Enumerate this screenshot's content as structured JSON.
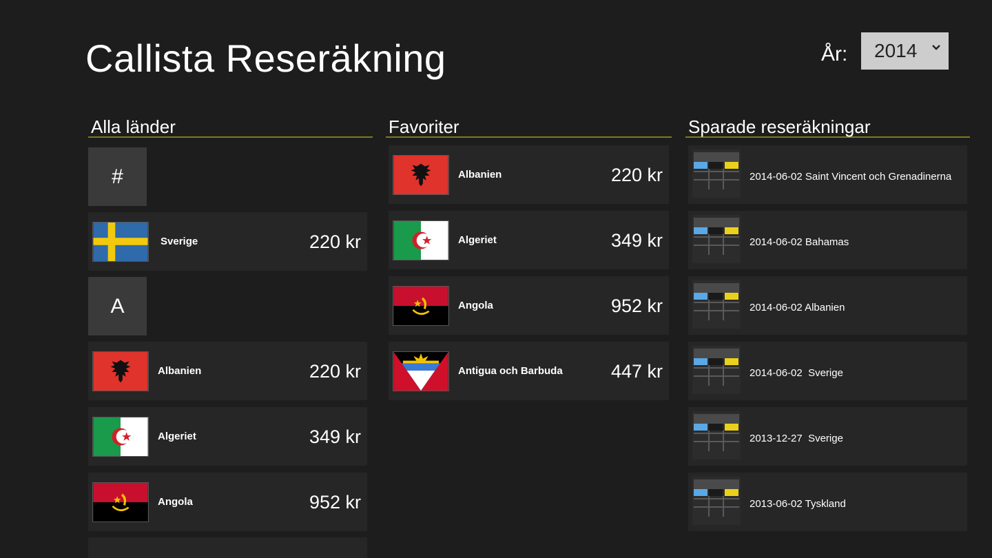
{
  "app": {
    "title": "Callista Reseräkning"
  },
  "year": {
    "label": "År:",
    "selected": "2014"
  },
  "sections": {
    "all": "Alla länder",
    "favorites": "Favoriter",
    "saved": "Sparade reseräkningar"
  },
  "all_countries": {
    "group_hash": "#",
    "group_a": "A",
    "items": [
      {
        "name": "Sverige",
        "price": "220 kr",
        "flag": "sweden-flag"
      },
      {
        "name": "Albanien",
        "price": "220 kr",
        "flag": "albania-flag"
      },
      {
        "name": "Algeriet",
        "price": "349 kr",
        "flag": "algeria-flag"
      },
      {
        "name": "Angola",
        "price": "952 kr",
        "flag": "angola-flag"
      }
    ]
  },
  "favorites": {
    "items": [
      {
        "name": "Albanien",
        "price": "220 kr",
        "flag": "albania-flag"
      },
      {
        "name": "Algeriet",
        "price": "349 kr",
        "flag": "algeria-flag"
      },
      {
        "name": "Angola",
        "price": "952 kr",
        "flag": "angola-flag"
      },
      {
        "name": "Antigua och Barbuda",
        "price": "447 kr",
        "flag": "antigua-flag"
      }
    ]
  },
  "saved": {
    "icon": "expense-sheet-icon",
    "items": [
      "2014-06-02 Saint Vincent och Grenadinerna",
      "2014-06-02 Bahamas",
      "2014-06-02 Albanien",
      "2014-06-02  Sverige",
      "2013-12-27  Sverige",
      "2013-06-02 Tyskland"
    ]
  },
  "colors": {
    "background": "#1d1d1d",
    "tile": "#262626",
    "group_tile": "#3a3a3a",
    "accent_line": "#807a1a",
    "select_bg": "#cdcdcd"
  }
}
